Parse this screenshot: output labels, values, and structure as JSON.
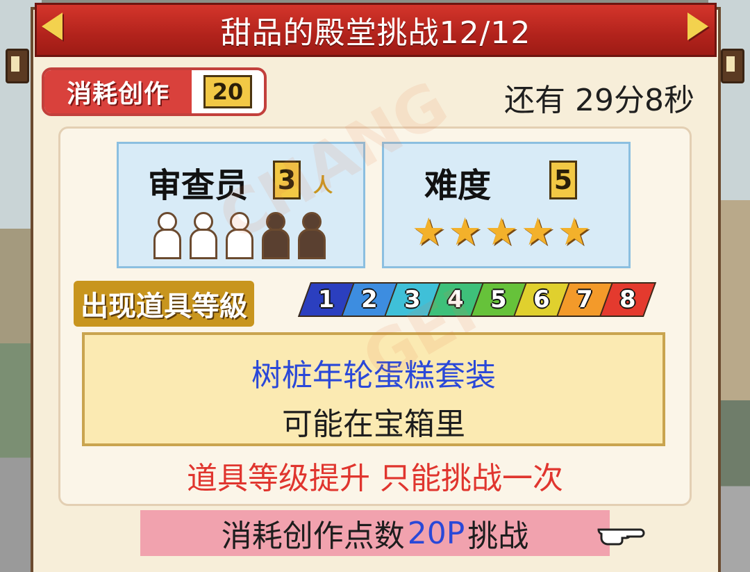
{
  "title": "甜品的殿堂挑战12/12",
  "cost": {
    "label": "消耗创作",
    "value": "20"
  },
  "time_left": "还有 29分8秒",
  "reviewers": {
    "label": "审查员",
    "count": "3",
    "unit": "人",
    "total_slots": 5,
    "active": 3
  },
  "difficulty": {
    "label": "难度",
    "value": "5",
    "stars": 5
  },
  "item_level": {
    "label": "出现道具等級",
    "levels": [
      "1",
      "2",
      "3",
      "4",
      "5",
      "6",
      "7",
      "8"
    ],
    "colors": [
      "#2b3fbf",
      "#3d8de0",
      "#3fc0d8",
      "#3ec07a",
      "#66c23a",
      "#e0d02e",
      "#f39a2a",
      "#e43a2e"
    ]
  },
  "item": {
    "name": "树桩年轮蛋糕套装",
    "location": "可能在宝箱里"
  },
  "note": "道具等级提升 只能挑战一次",
  "challenge_button": {
    "prefix": "消耗创作点数 ",
    "amount": "20P",
    "suffix": "挑战"
  },
  "icons": {
    "prev": "left-arrow-icon",
    "next": "right-arrow-icon",
    "pointer": "pointing-hand-icon"
  }
}
